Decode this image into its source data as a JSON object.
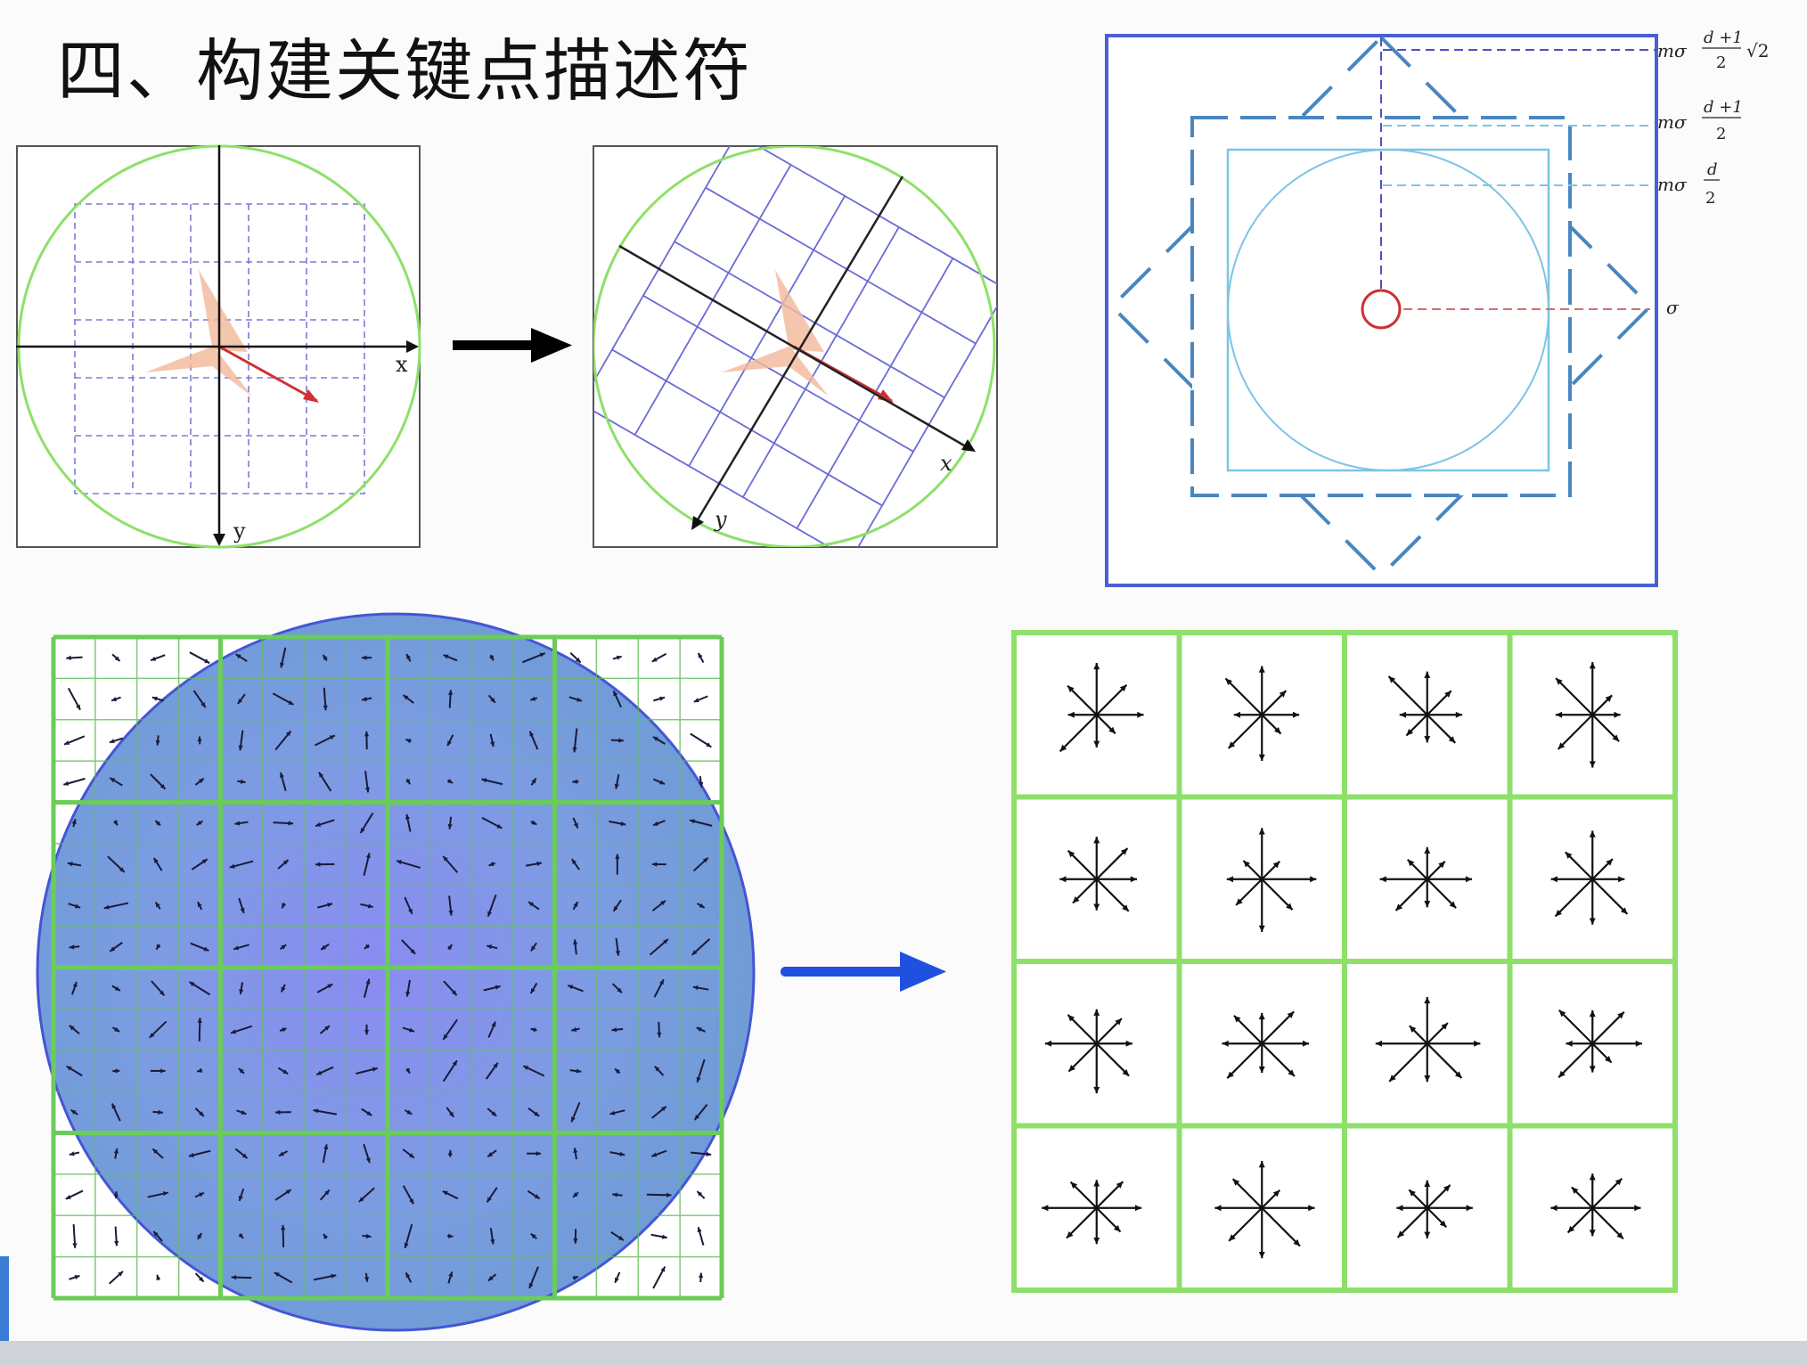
{
  "title": "四、构建关键点描述符",
  "panel1": {
    "x_label": "x",
    "y_label": "y"
  },
  "panel2": {
    "x_label": "x",
    "y_label": "y"
  },
  "scale_diagram": {
    "label_sqrt2": "mσ (d+1)/2 √2",
    "label_d1": "mσ (d+1)/2",
    "label_d": "mσ d/2",
    "label_sigma": "σ",
    "frac_num_1": "d +1",
    "frac_den": "2",
    "frac_num_d": "d",
    "m_sigma": "mσ",
    "sqrt2": "√2"
  },
  "colors": {
    "green": "#8ee06a",
    "purple_grid": "#7070dd",
    "blue_square": "#4a5fd6",
    "dashed_blue": "#4a86c0",
    "light_blue": "#7cc4e6",
    "red": "#d03030",
    "circle_fill": "#5b7fd8",
    "arrow_blue": "#2050e0"
  }
}
